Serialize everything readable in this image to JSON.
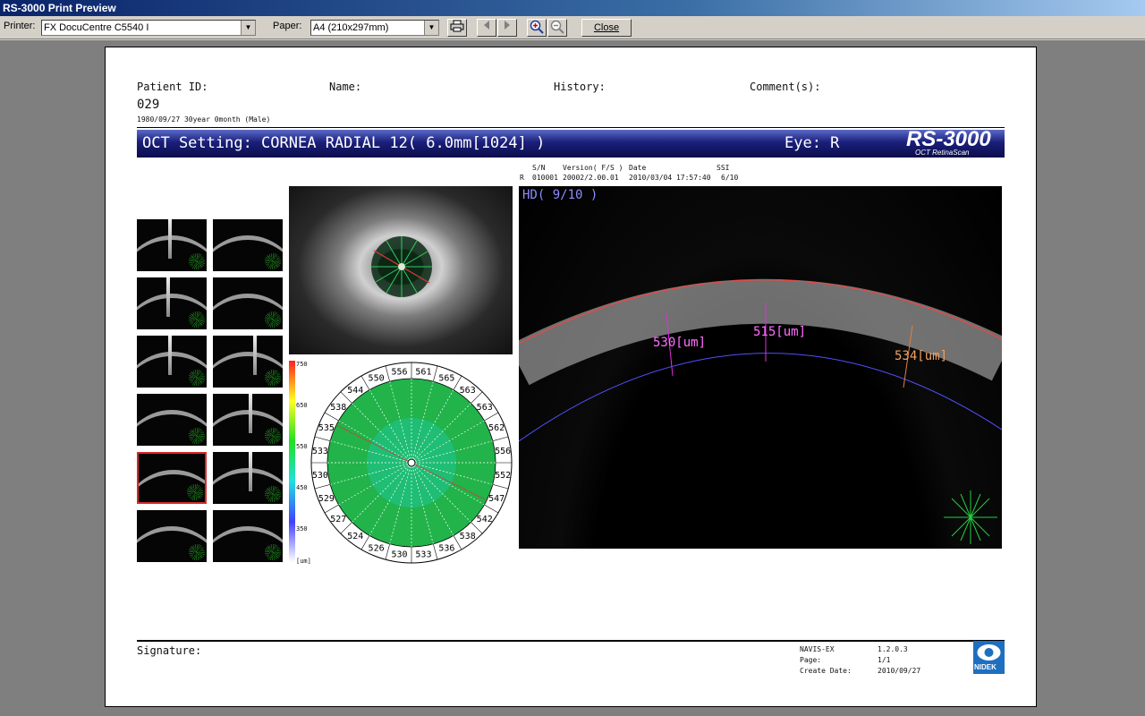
{
  "window": {
    "title": "RS-3000 Print Preview"
  },
  "toolbar": {
    "printer_label": "Printer:",
    "printer_value": "FX DocuCentre C5540 I",
    "paper_label": "Paper:",
    "paper_value": "A4 (210x297mm)",
    "close_label": "Close",
    "icons": [
      "printer-icon",
      "prev-page-icon",
      "next-page-icon",
      "zoom-in-icon",
      "zoom-out-icon"
    ]
  },
  "report": {
    "patient_id_label": "Patient ID:",
    "name_label": "Name:",
    "history_label": "History:",
    "comments_label": "Comment(s):",
    "patient_id": "029",
    "dob_line": "1980/09/27 30year 0month (Male)",
    "oct_setting": "OCT Setting: CORNEA RADIAL 12( 6.0mm[1024] )",
    "eye": "Eye: R",
    "brand_logo": "RS-3000",
    "brand_sub": "OCT RetinaScan",
    "info_headers": {
      "sn": "S/N",
      "version": "Version( F/S )",
      "date": "Date",
      "ssi": "SSI"
    },
    "info_values": {
      "eye": "R",
      "sn": "010001",
      "version": "20002/2.00.01",
      "date": "2010/03/04 17:57:40",
      "ssi": "6/10"
    },
    "hd_label": "HD( 9/10 )",
    "measurements": [
      "530[um]",
      "515[um]",
      "534[um]"
    ],
    "scale_ticks": [
      "750",
      "650",
      "550",
      "450",
      "350",
      "[um]"
    ],
    "thickness_values": [
      "561",
      "565",
      "563",
      "563",
      "562",
      "556",
      "552",
      "547",
      "542",
      "538",
      "536",
      "533",
      "530",
      "526",
      "524",
      "527",
      "529",
      "530",
      "533",
      "535",
      "538",
      "544",
      "550",
      "556"
    ],
    "signature_label": "Signature:",
    "footer": {
      "software_label": "NAVIS-EX",
      "software_value": "1.2.0.3",
      "page_label": "Page:",
      "page_value": "1/1",
      "create_label": "Create Date:",
      "create_value": "2010/09/27"
    },
    "nidek_logo": "NIDEK"
  }
}
